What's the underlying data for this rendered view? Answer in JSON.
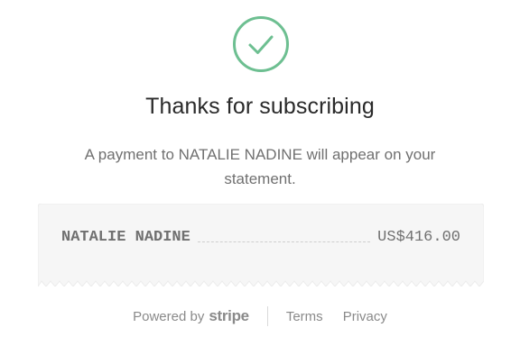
{
  "icon": {
    "name": "checkmark-circle-icon",
    "color": "#6dbf91"
  },
  "title": "Thanks for subscribing",
  "subtitle": "A payment to NATALIE NADINE will appear on your statement.",
  "receipt": {
    "merchant": "NATALIE NADINE",
    "amount": "US$416.00"
  },
  "footer": {
    "powered_by": "Powered by",
    "brand": "stripe",
    "links": [
      "Terms",
      "Privacy"
    ]
  },
  "colors": {
    "accent": "#6dbf91",
    "text_dark": "#2a2a2a",
    "text_muted": "#707070",
    "receipt_bg": "#f6f6f6"
  }
}
